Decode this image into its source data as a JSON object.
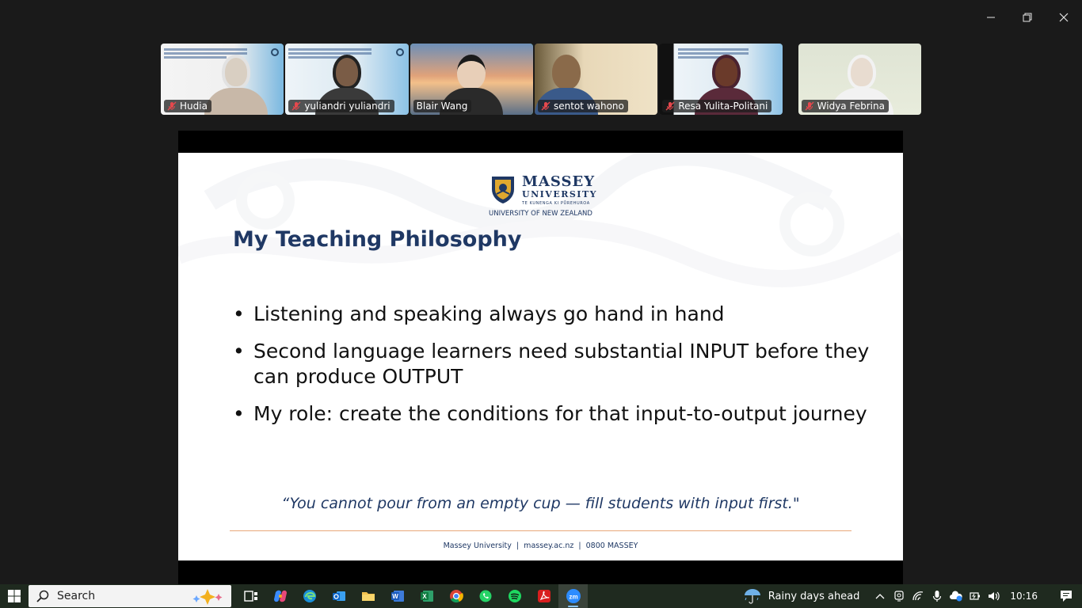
{
  "participants": [
    {
      "name": "Hudia",
      "muted": true
    },
    {
      "name": "yuliandri yuliandri",
      "muted": true
    },
    {
      "name": "Blair Wang",
      "muted": false,
      "active": true
    },
    {
      "name": "sentot wahono",
      "muted": true
    },
    {
      "name": "Resa Yulita-Politani",
      "muted": true
    },
    {
      "name": "Widya Febrina",
      "muted": true
    }
  ],
  "slide": {
    "brand": {
      "line1": "MASSEY",
      "line2": "UNIVERSITY",
      "line3": "TE KUNENGA KI PŪREHUROA",
      "line4": "UNIVERSITY OF NEW ZEALAND"
    },
    "title": "My Teaching Philosophy",
    "bullets": [
      "Listening and speaking always go hand in hand",
      "Second language learners need substantial INPUT before they can produce OUTPUT",
      "My role: create the conditions for that input-to-output journey"
    ],
    "quote": "“You cannot pour from an empty cup — fill students with input first.\"",
    "footer": "Massey University  |  massey.ac.nz  |  0800 MASSEY"
  },
  "taskbar": {
    "search_label": "Search",
    "weather_text": "Rainy days ahead",
    "time": "10:16"
  },
  "colors": {
    "active_speaker": "#2fd75d",
    "brand_navy": "#1f3864",
    "rule": "#e8a77a"
  }
}
